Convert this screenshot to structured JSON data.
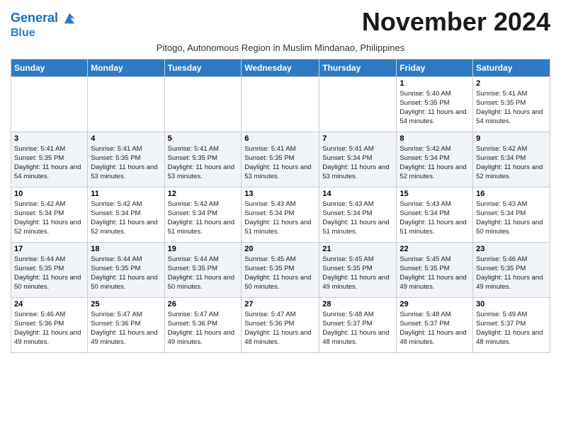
{
  "header": {
    "logo_line1": "General",
    "logo_line2": "Blue",
    "month_year": "November 2024",
    "subtitle": "Pitogo, Autonomous Region in Muslim Mindanao, Philippines"
  },
  "days_of_week": [
    "Sunday",
    "Monday",
    "Tuesday",
    "Wednesday",
    "Thursday",
    "Friday",
    "Saturday"
  ],
  "weeks": [
    [
      {
        "day": "",
        "info": ""
      },
      {
        "day": "",
        "info": ""
      },
      {
        "day": "",
        "info": ""
      },
      {
        "day": "",
        "info": ""
      },
      {
        "day": "",
        "info": ""
      },
      {
        "day": "1",
        "info": "Sunrise: 5:40 AM\nSunset: 5:35 PM\nDaylight: 11 hours and 54 minutes."
      },
      {
        "day": "2",
        "info": "Sunrise: 5:41 AM\nSunset: 5:35 PM\nDaylight: 11 hours and 54 minutes."
      }
    ],
    [
      {
        "day": "3",
        "info": "Sunrise: 5:41 AM\nSunset: 5:35 PM\nDaylight: 11 hours and 54 minutes."
      },
      {
        "day": "4",
        "info": "Sunrise: 5:41 AM\nSunset: 5:35 PM\nDaylight: 11 hours and 53 minutes."
      },
      {
        "day": "5",
        "info": "Sunrise: 5:41 AM\nSunset: 5:35 PM\nDaylight: 11 hours and 53 minutes."
      },
      {
        "day": "6",
        "info": "Sunrise: 5:41 AM\nSunset: 5:35 PM\nDaylight: 11 hours and 53 minutes."
      },
      {
        "day": "7",
        "info": "Sunrise: 5:41 AM\nSunset: 5:34 PM\nDaylight: 11 hours and 53 minutes."
      },
      {
        "day": "8",
        "info": "Sunrise: 5:42 AM\nSunset: 5:34 PM\nDaylight: 11 hours and 52 minutes."
      },
      {
        "day": "9",
        "info": "Sunrise: 5:42 AM\nSunset: 5:34 PM\nDaylight: 11 hours and 52 minutes."
      }
    ],
    [
      {
        "day": "10",
        "info": "Sunrise: 5:42 AM\nSunset: 5:34 PM\nDaylight: 11 hours and 52 minutes."
      },
      {
        "day": "11",
        "info": "Sunrise: 5:42 AM\nSunset: 5:34 PM\nDaylight: 11 hours and 52 minutes."
      },
      {
        "day": "12",
        "info": "Sunrise: 5:42 AM\nSunset: 5:34 PM\nDaylight: 11 hours and 51 minutes."
      },
      {
        "day": "13",
        "info": "Sunrise: 5:43 AM\nSunset: 5:34 PM\nDaylight: 11 hours and 51 minutes."
      },
      {
        "day": "14",
        "info": "Sunrise: 5:43 AM\nSunset: 5:34 PM\nDaylight: 11 hours and 51 minutes."
      },
      {
        "day": "15",
        "info": "Sunrise: 5:43 AM\nSunset: 5:34 PM\nDaylight: 11 hours and 51 minutes."
      },
      {
        "day": "16",
        "info": "Sunrise: 5:43 AM\nSunset: 5:34 PM\nDaylight: 11 hours and 50 minutes."
      }
    ],
    [
      {
        "day": "17",
        "info": "Sunrise: 5:44 AM\nSunset: 5:35 PM\nDaylight: 11 hours and 50 minutes."
      },
      {
        "day": "18",
        "info": "Sunrise: 5:44 AM\nSunset: 5:35 PM\nDaylight: 11 hours and 50 minutes."
      },
      {
        "day": "19",
        "info": "Sunrise: 5:44 AM\nSunset: 5:35 PM\nDaylight: 11 hours and 50 minutes."
      },
      {
        "day": "20",
        "info": "Sunrise: 5:45 AM\nSunset: 5:35 PM\nDaylight: 11 hours and 50 minutes."
      },
      {
        "day": "21",
        "info": "Sunrise: 5:45 AM\nSunset: 5:35 PM\nDaylight: 11 hours and 49 minutes."
      },
      {
        "day": "22",
        "info": "Sunrise: 5:45 AM\nSunset: 5:35 PM\nDaylight: 11 hours and 49 minutes."
      },
      {
        "day": "23",
        "info": "Sunrise: 5:46 AM\nSunset: 5:35 PM\nDaylight: 11 hours and 49 minutes."
      }
    ],
    [
      {
        "day": "24",
        "info": "Sunrise: 5:46 AM\nSunset: 5:36 PM\nDaylight: 11 hours and 49 minutes."
      },
      {
        "day": "25",
        "info": "Sunrise: 5:47 AM\nSunset: 5:36 PM\nDaylight: 11 hours and 49 minutes."
      },
      {
        "day": "26",
        "info": "Sunrise: 5:47 AM\nSunset: 5:36 PM\nDaylight: 11 hours and 49 minutes."
      },
      {
        "day": "27",
        "info": "Sunrise: 5:47 AM\nSunset: 5:36 PM\nDaylight: 11 hours and 48 minutes."
      },
      {
        "day": "28",
        "info": "Sunrise: 5:48 AM\nSunset: 5:37 PM\nDaylight: 11 hours and 48 minutes."
      },
      {
        "day": "29",
        "info": "Sunrise: 5:48 AM\nSunset: 5:37 PM\nDaylight: 11 hours and 48 minutes."
      },
      {
        "day": "30",
        "info": "Sunrise: 5:49 AM\nSunset: 5:37 PM\nDaylight: 11 hours and 48 minutes."
      }
    ]
  ]
}
